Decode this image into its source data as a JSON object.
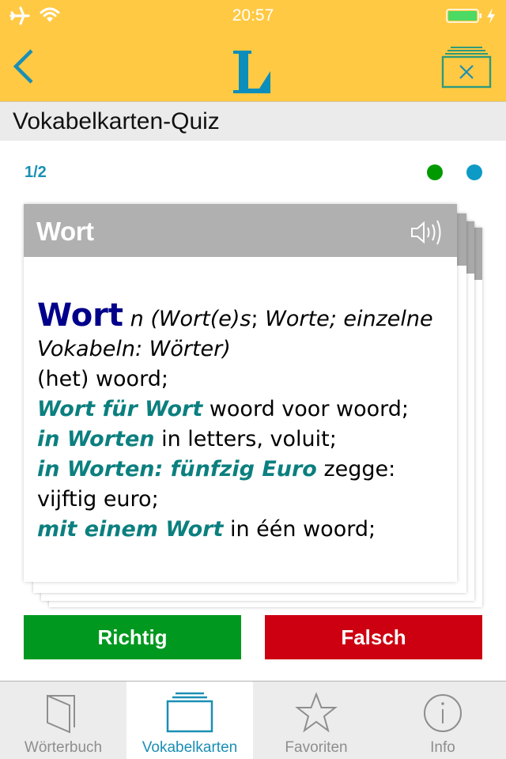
{
  "status_bar": {
    "time": "20:57",
    "icons": [
      "airplane-icon",
      "wifi-icon",
      "battery-icon",
      "charging-bolt-icon"
    ]
  },
  "nav": {
    "back_icon": "chevron-left-icon",
    "logo_letter": "L",
    "close_quiz_icon": "card-stack-close-icon"
  },
  "section": {
    "title": "Vokabelkarten-Quiz"
  },
  "quiz": {
    "progress": "1/2",
    "indicators": [
      {
        "status": "correct",
        "color": "#009a00"
      },
      {
        "status": "current",
        "color": "#0d9ac5"
      }
    ]
  },
  "card": {
    "title": "Wort",
    "speaker_icon": "speaker-icon",
    "headword": "Wort",
    "grammar_1": "n (Wort(e)s",
    "grammar_sep": ";",
    "grammar_2": " Worte",
    "grammar_3": "; einzelne Vokabeln: Wörter)",
    "translation_main": "(het) woord;",
    "examples": [
      {
        "phrase": "Wort für Wort",
        "translation": " woord voor woord;"
      },
      {
        "phrase": "in Worten",
        "translation": " in letters, voluit;"
      },
      {
        "phrase": "in Worten: fünfzig Euro",
        "translation": " zegge: vijftig euro;"
      },
      {
        "phrase": "mit einem Wort",
        "translation": " in één woord;"
      }
    ]
  },
  "buttons": {
    "correct_label": "Richtig",
    "wrong_label": "Falsch"
  },
  "tabbar": {
    "tabs": [
      {
        "label": "Wörterbuch",
        "icon": "book-icon",
        "active": false
      },
      {
        "label": "Vokabelkarten",
        "icon": "flashcards-icon",
        "active": true
      },
      {
        "label": "Favoriten",
        "icon": "star-icon",
        "active": false
      },
      {
        "label": "Info",
        "icon": "info-icon",
        "active": false
      }
    ]
  },
  "colors": {
    "brand_yellow": "#ffc943",
    "accent_blue": "#1a8fb5",
    "correct_green": "#01981f",
    "wrong_red": "#cc0010",
    "example_teal": "#0c7f7f",
    "headword_navy": "#00008b"
  }
}
